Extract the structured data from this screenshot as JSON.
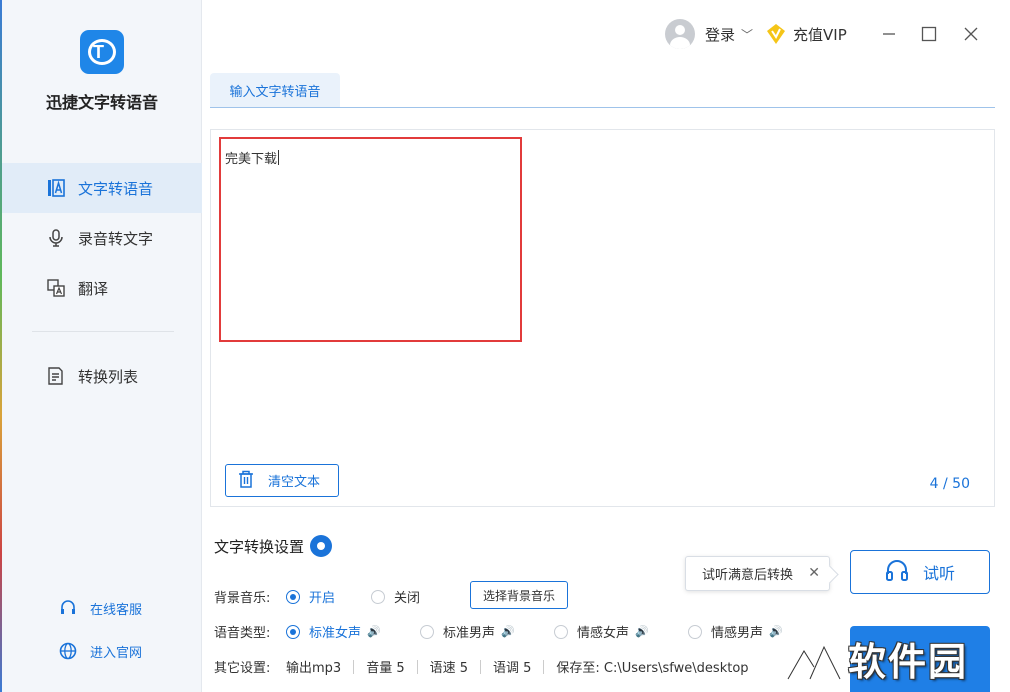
{
  "app": {
    "name": "迅捷文字转语音",
    "logo_text": "T"
  },
  "sidebar": {
    "items": [
      {
        "label": "文字转语音",
        "icon": "text-speech-icon",
        "active": true
      },
      {
        "label": "录音转文字",
        "icon": "microphone-icon",
        "active": false
      },
      {
        "label": "翻译",
        "icon": "translate-icon",
        "active": false
      },
      {
        "label": "转换列表",
        "icon": "list-icon",
        "active": false
      }
    ],
    "footer": [
      {
        "label": "在线客服",
        "icon": "headset-icon"
      },
      {
        "label": "进入官网",
        "icon": "globe-icon"
      }
    ]
  },
  "topbar": {
    "login": "登录",
    "vip": "充值VIP"
  },
  "tab": {
    "label": "输入文字转语音"
  },
  "editor": {
    "text": "完美下载",
    "clear_label": "清空文本",
    "counter": "4 / 50"
  },
  "settings": {
    "title": "文字转换设置",
    "bg_music": {
      "label": "背景音乐:",
      "options": [
        "开启",
        "关闭"
      ],
      "selected": "开启",
      "choose_label": "选择背景音乐"
    },
    "voice": {
      "label": "语音类型:",
      "options": [
        "标准女声",
        "标准男声",
        "情感女声",
        "情感男声"
      ],
      "selected": "标准女声"
    },
    "other": {
      "label": "其它设置:",
      "output": "输出mp3",
      "volume": "音量 5",
      "speed": "语速 5",
      "pitch": "语调 5",
      "save_to": "保存至: C:\\Users\\sfwe\\desktop"
    }
  },
  "tooltip": {
    "text": "试听满意后转换"
  },
  "actions": {
    "listen_label": "试听"
  },
  "watermark": {
    "text": "软件园"
  },
  "colors": {
    "accent": "#1a73d9",
    "highlight_box": "#e23b3b",
    "sidebar_bg": "#f3f6fa"
  }
}
